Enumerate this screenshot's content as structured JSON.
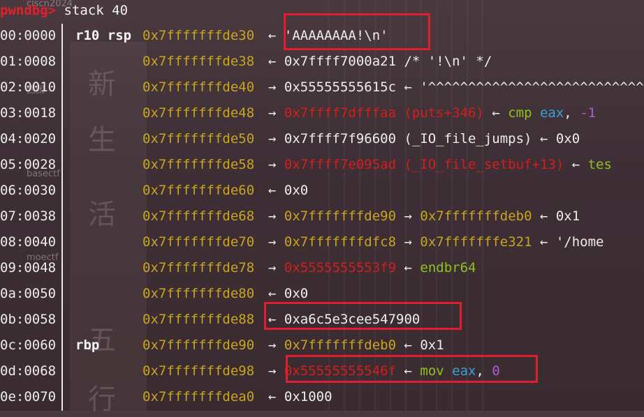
{
  "background": {
    "chars": [
      "新",
      "生",
      "活",
      "五",
      "行"
    ],
    "labels": [
      "ciscn2024",
      "西团",
      "basectf",
      "moectf"
    ]
  },
  "prompt": {
    "text": "pwndbg>",
    "command": " stack 40"
  },
  "rows": [
    {
      "offset": "00:0000",
      "reg": "r10 rsp",
      "addr": "0x7fffffffde30",
      "arrow": "←",
      "parts": [
        {
          "t": " 'AAAAAAAA!\\n'",
          "c": "wht"
        }
      ]
    },
    {
      "offset": "01:0008",
      "reg": "",
      "addr": "0x7fffffffde38",
      "arrow": "←",
      "parts": [
        {
          "t": " 0x7ffff7000a21 /* '!\\n' */",
          "c": "wht"
        }
      ]
    },
    {
      "offset": "02:0010",
      "reg": "",
      "addr": "0x7fffffffde40",
      "arrow": "→",
      "parts": [
        {
          "t": " 0x55555555615c",
          "c": "wht"
        },
        {
          "t": " ← '^^^^^^^^^^^^^^^^^^^^^^^^^^^^^",
          "c": "wht"
        }
      ]
    },
    {
      "offset": "03:0018",
      "reg": "",
      "addr": "0x7fffffffde48",
      "arrow": "→",
      "parts": [
        {
          "t": " 0x7ffff7dfffaa (puts+346)",
          "c": "red"
        },
        {
          "t": " ← ",
          "c": "wht"
        },
        {
          "t": "cmp ",
          "c": "grn"
        },
        {
          "t": "eax",
          "c": "blu"
        },
        {
          "t": ", ",
          "c": "wht"
        },
        {
          "t": "-1",
          "c": "mag"
        }
      ]
    },
    {
      "offset": "04:0020",
      "reg": "",
      "addr": "0x7fffffffde50",
      "arrow": "→",
      "parts": [
        {
          "t": " 0x7ffff7f96600 (_IO_file_jumps)",
          "c": "wht"
        },
        {
          "t": " ← 0x0",
          "c": "wht"
        }
      ]
    },
    {
      "offset": "05:0028",
      "reg": "",
      "addr": "0x7fffffffde58",
      "arrow": "→",
      "parts": [
        {
          "t": " 0x7ffff7e095ad (_IO_file_setbuf+13)",
          "c": "red"
        },
        {
          "t": " ← ",
          "c": "wht"
        },
        {
          "t": "tes",
          "c": "grn"
        }
      ]
    },
    {
      "offset": "06:0030",
      "reg": "",
      "addr": "0x7fffffffde60",
      "arrow": "←",
      "parts": [
        {
          "t": " 0x0",
          "c": "wht"
        }
      ]
    },
    {
      "offset": "07:0038",
      "reg": "",
      "addr": "0x7fffffffde68",
      "arrow": "→",
      "parts": [
        {
          "t": " 0x7fffffffde90",
          "c": "yel"
        },
        {
          "t": " → ",
          "c": "wht"
        },
        {
          "t": "0x7fffffffdeb0",
          "c": "yel"
        },
        {
          "t": " ← 0x1",
          "c": "wht"
        }
      ]
    },
    {
      "offset": "08:0040",
      "reg": "",
      "addr": "0x7fffffffde70",
      "arrow": "→",
      "parts": [
        {
          "t": " 0x7fffffffdfc8",
          "c": "yel"
        },
        {
          "t": " → ",
          "c": "wht"
        },
        {
          "t": "0x7fffffffe321",
          "c": "yel"
        },
        {
          "t": " ← '/home",
          "c": "wht"
        }
      ]
    },
    {
      "offset": "09:0048",
      "reg": "",
      "addr": "0x7fffffffde78",
      "arrow": "→",
      "parts": [
        {
          "t": " 0x5555555553f9",
          "c": "red"
        },
        {
          "t": " ← ",
          "c": "wht"
        },
        {
          "t": "endbr64",
          "c": "grn"
        }
      ]
    },
    {
      "offset": "0a:0050",
      "reg": "",
      "addr": "0x7fffffffde80",
      "arrow": "←",
      "parts": [
        {
          "t": " 0x0",
          "c": "wht"
        }
      ]
    },
    {
      "offset": "0b:0058",
      "reg": "",
      "addr": "0x7fffffffde88",
      "arrow": "←",
      "parts": [
        {
          "t": " 0xa6c5e3cee547900",
          "c": "wht"
        }
      ]
    },
    {
      "offset": "0c:0060",
      "reg": "rbp",
      "addr": "0x7fffffffde90",
      "arrow": "→",
      "parts": [
        {
          "t": " 0x7fffffffdeb0",
          "c": "yel"
        },
        {
          "t": " ← 0x1",
          "c": "wht"
        }
      ]
    },
    {
      "offset": "0d:0068",
      "reg": "",
      "addr": "0x7fffffffde98",
      "arrow": "→",
      "parts": [
        {
          "t": " 0x55555555546f",
          "c": "red"
        },
        {
          "t": " ← ",
          "c": "wht"
        },
        {
          "t": "mov ",
          "c": "grn"
        },
        {
          "t": "eax",
          "c": "blu"
        },
        {
          "t": ", ",
          "c": "wht"
        },
        {
          "t": "0",
          "c": "mag"
        }
      ]
    },
    {
      "offset": "0e:0070",
      "reg": "",
      "addr": "0x7fffffffdea0",
      "arrow": "←",
      "parts": [
        {
          "t": " 0x1000",
          "c": "wht"
        }
      ]
    }
  ],
  "colors": {
    "prompt": "#e0202a",
    "address": "#c9a51e",
    "highlight_box": "#e01e2e",
    "code": "#8ec21e",
    "register": "#3aa0d8",
    "number": "#b35bd6",
    "symbol": "#d41e1e"
  }
}
